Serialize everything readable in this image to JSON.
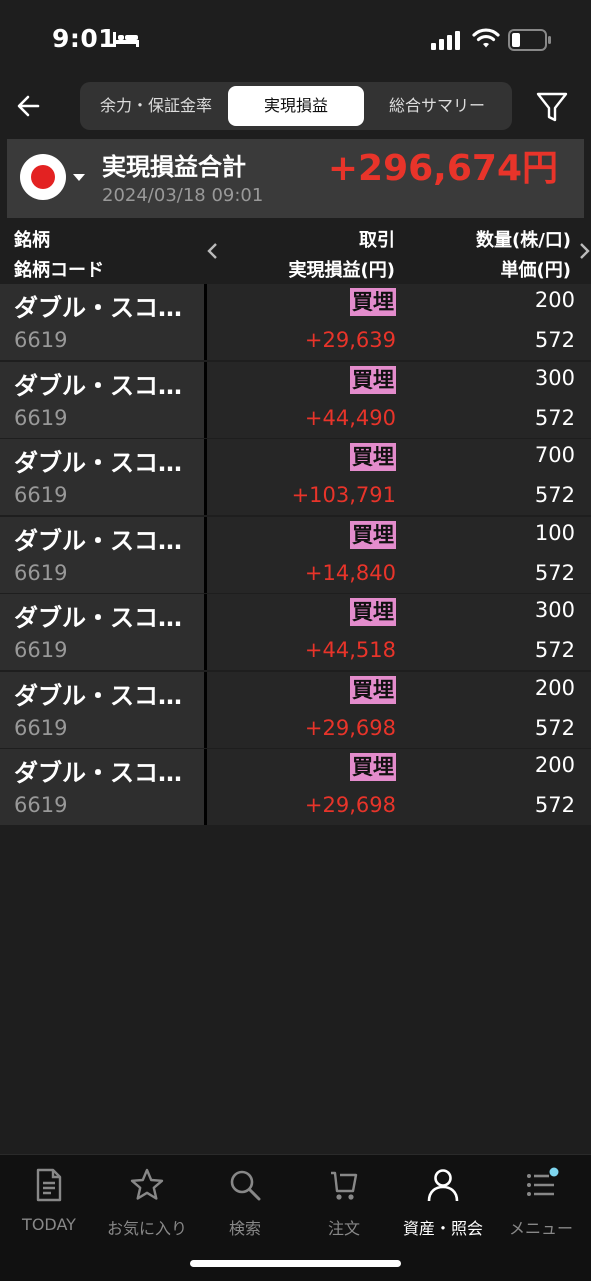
{
  "status": {
    "time": "9:01"
  },
  "nav": {
    "tabs": [
      {
        "label": "余力・保証金率",
        "active": false
      },
      {
        "label": "実現損益",
        "active": true
      },
      {
        "label": "総合サマリー",
        "active": false
      }
    ]
  },
  "summary": {
    "title": "実現損益合計",
    "date": "2024/03/18 09:01",
    "total": "+296,674円"
  },
  "columns": {
    "col1_line1": "銘柄",
    "col1_line2": "銘柄コード",
    "col2_line1": "取引",
    "col2_line2": "実現損益(円)",
    "col3_line1": "数量(株/口)",
    "col3_line2": "単価(円)"
  },
  "rows": [
    {
      "name": "ダブル・スコ…",
      "code": "6619",
      "trade": "買埋",
      "pnl": "+29,639",
      "qty": "200",
      "price": "572"
    },
    {
      "name": "ダブル・スコ…",
      "code": "6619",
      "trade": "買埋",
      "pnl": "+44,490",
      "qty": "300",
      "price": "572"
    },
    {
      "name": "ダブル・スコ…",
      "code": "6619",
      "trade": "買埋",
      "pnl": "+103,791",
      "qty": "700",
      "price": "572"
    },
    {
      "name": "ダブル・スコ…",
      "code": "6619",
      "trade": "買埋",
      "pnl": "+14,840",
      "qty": "100",
      "price": "572"
    },
    {
      "name": "ダブル・スコ…",
      "code": "6619",
      "trade": "買埋",
      "pnl": "+44,518",
      "qty": "300",
      "price": "572"
    },
    {
      "name": "ダブル・スコ…",
      "code": "6619",
      "trade": "買埋",
      "pnl": "+29,698",
      "qty": "200",
      "price": "572"
    },
    {
      "name": "ダブル・スコ…",
      "code": "6619",
      "trade": "買埋",
      "pnl": "+29,698",
      "qty": "200",
      "price": "572"
    }
  ],
  "tabbar": {
    "items": [
      {
        "label": "TODAY",
        "icon": "document-icon"
      },
      {
        "label": "お気に入り",
        "icon": "star-icon"
      },
      {
        "label": "検索",
        "icon": "search-icon"
      },
      {
        "label": "注文",
        "icon": "cart-icon"
      },
      {
        "label": "資産・照会",
        "icon": "person-icon",
        "active": true
      },
      {
        "label": "メニュー",
        "icon": "menu-icon"
      }
    ]
  },
  "colors": {
    "positive": "#e8342a",
    "badge": "#e38ccc",
    "accent_dot": "#7fd6ef"
  }
}
